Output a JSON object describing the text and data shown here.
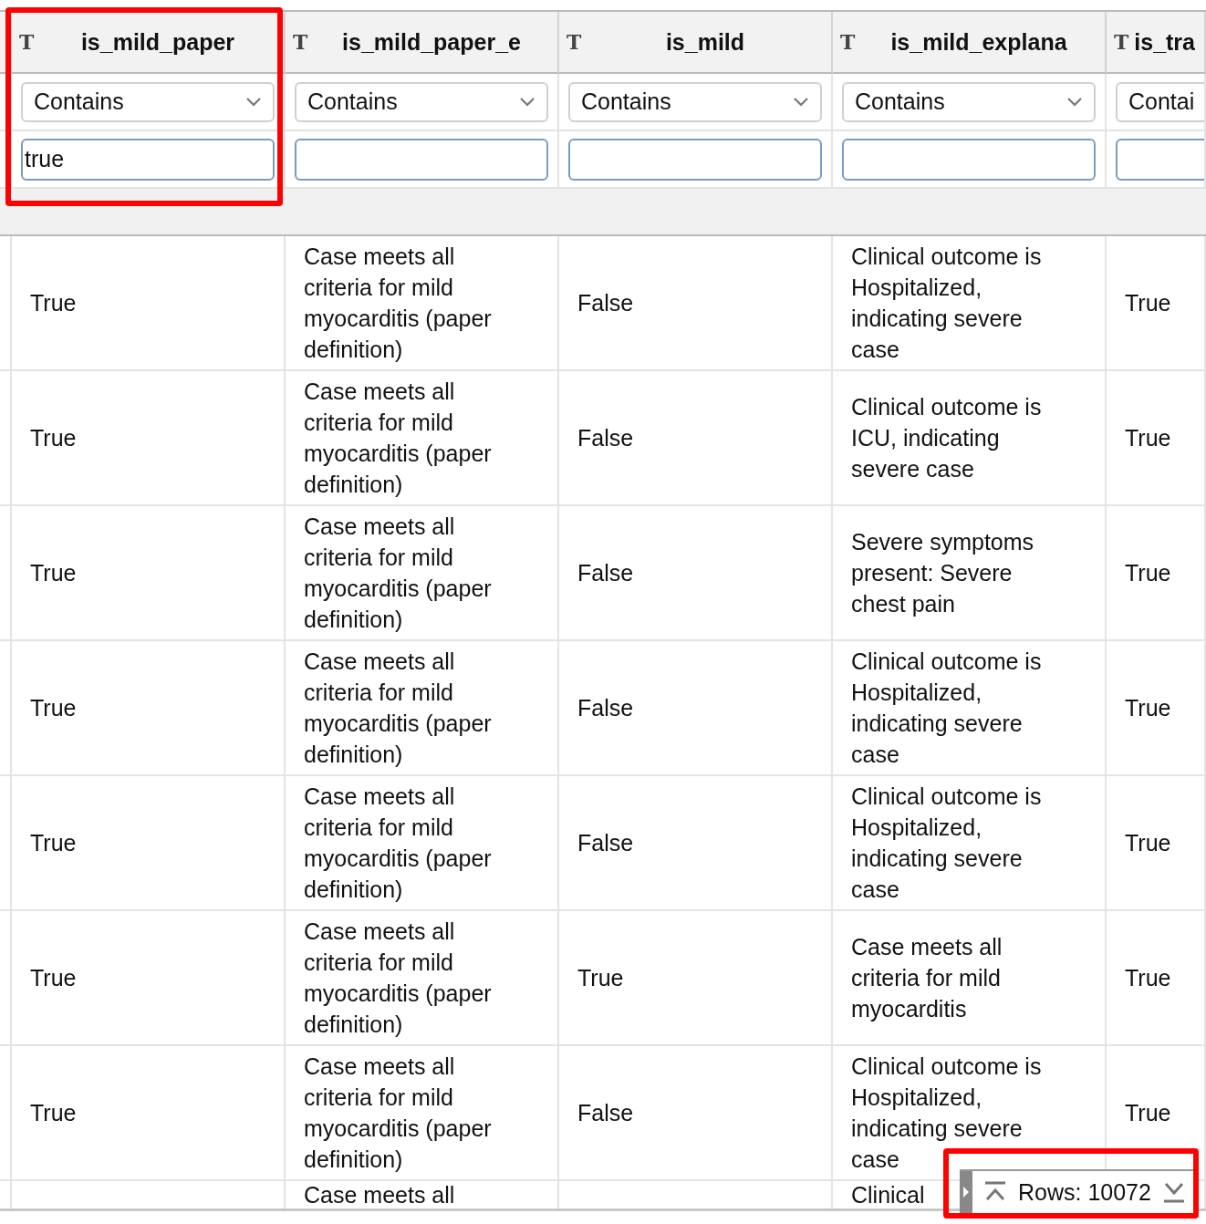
{
  "columns": [
    {
      "type_mark": "T",
      "name": "is_mild_paper",
      "operator": "Contains",
      "filter": "true",
      "highlighted": true
    },
    {
      "type_mark": "T",
      "name": "is_mild_paper_e",
      "operator": "Contains",
      "highlighted": false
    },
    {
      "type_mark": "T",
      "name": "is_mild",
      "operator": "Contains",
      "highlighted": false
    },
    {
      "type_mark": "T",
      "name": "is_mild_explana",
      "operator": "Contains",
      "highlighted": false
    },
    {
      "type_mark": "T",
      "name": "is_tra",
      "operator": "Contai",
      "highlighted": false
    }
  ],
  "rows": [
    [
      "True",
      "Case meets all criteria for mild myocarditis (paper definition)",
      "False",
      "Clinical outcome is Hospitalized, indicating severe case",
      "True"
    ],
    [
      "True",
      "Case meets all criteria for mild myocarditis (paper definition)",
      "False",
      "Clinical outcome is ICU, indicating severe case",
      "True"
    ],
    [
      "True",
      "Case meets all criteria for mild myocarditis (paper definition)",
      "False",
      "Severe symptoms present: Severe chest pain",
      "True"
    ],
    [
      "True",
      "Case meets all criteria for mild myocarditis (paper definition)",
      "False",
      "Clinical outcome is Hospitalized, indicating severe case",
      "True"
    ],
    [
      "True",
      "Case meets all criteria for mild myocarditis (paper definition)",
      "False",
      "Clinical outcome is Hospitalized, indicating severe case",
      "True"
    ],
    [
      "True",
      "Case meets all criteria for mild myocarditis (paper definition)",
      "True",
      "Case meets all criteria for mild myocarditis",
      "True"
    ],
    [
      "True",
      "Case meets all criteria for mild myocarditis (paper definition)",
      "False",
      "Clinical outcome is Hospitalized, indicating severe case",
      "True"
    ],
    [
      "",
      "Case meets all",
      "",
      "Clinical",
      ""
    ]
  ],
  "row_count": {
    "label": "Rows: 10072",
    "highlighted": true
  }
}
